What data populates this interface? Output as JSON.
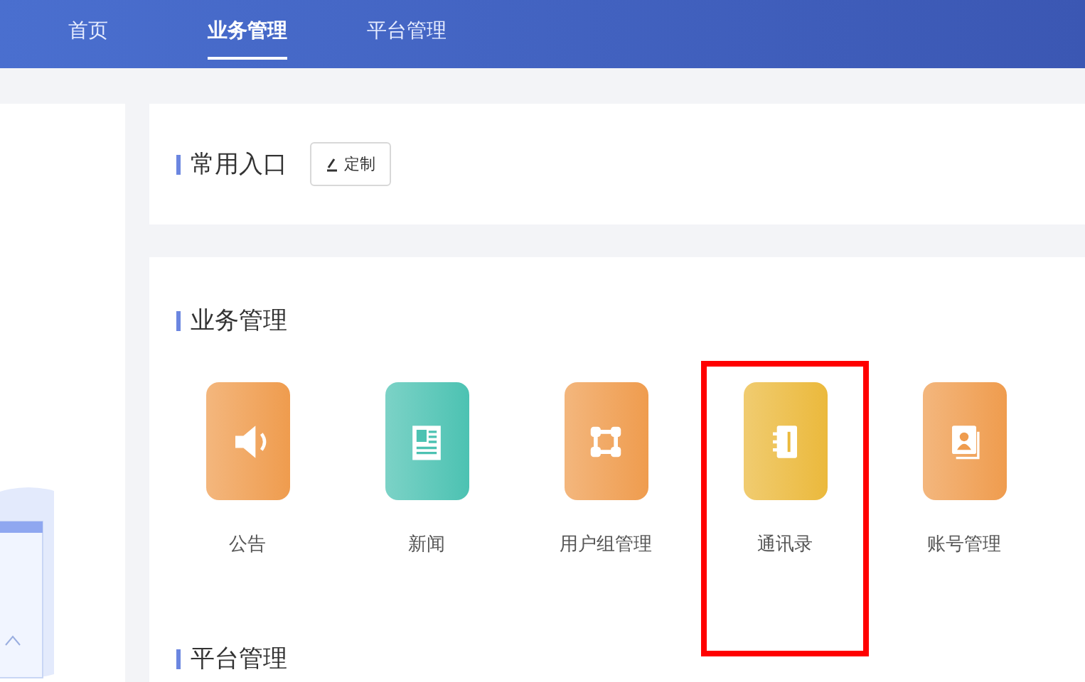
{
  "nav": {
    "tabs": [
      {
        "label": "首页",
        "selected": false
      },
      {
        "label": "业务管理",
        "selected": true
      },
      {
        "label": "平台管理",
        "selected": false
      }
    ]
  },
  "shortcuts": {
    "title": "常用入口",
    "customize_button": "定制"
  },
  "sections": [
    {
      "title": "业务管理",
      "items": [
        {
          "label": "公告",
          "kind": "speaker",
          "color": "#ef9c4e",
          "highlighted": false
        },
        {
          "label": "新闻",
          "kind": "news",
          "color": "#4cc2b2",
          "highlighted": false
        },
        {
          "label": "用户组管理",
          "kind": "group",
          "color": "#ef9c4e",
          "highlighted": false
        },
        {
          "label": "通讯录",
          "kind": "notebook",
          "color": "#ebb93c",
          "highlighted": true
        },
        {
          "label": "账号管理",
          "kind": "contact",
          "color": "#ef9c4e",
          "highlighted": false
        }
      ]
    },
    {
      "title": "平台管理"
    }
  ]
}
